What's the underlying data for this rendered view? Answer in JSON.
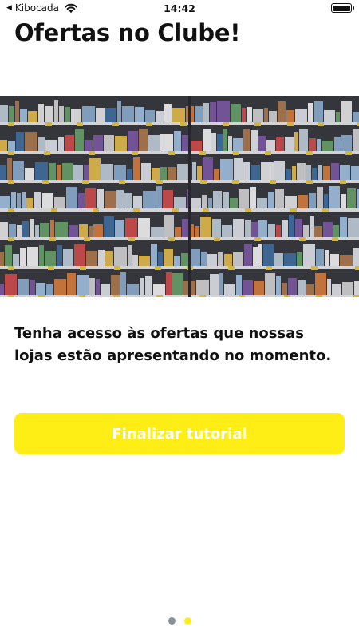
{
  "status_bar": {
    "back_symbol": "◀",
    "carrier": "Kibocada",
    "time": "14:42",
    "icons": [
      "back-arrow-icon",
      "wifi-icon",
      "battery-icon"
    ]
  },
  "screen": {
    "title": "Ofertas no Clube!",
    "hero_image": "supermarket-shelves-photo",
    "description": "Tenha acesso às ofertas que nossas lojas estão apresentando no momento.",
    "primary_button_label": "Finalizar tutorial"
  },
  "pager": {
    "pages": 2,
    "active_index": 1
  },
  "colors": {
    "accent": "#ffee15",
    "button_text": "#ffffff",
    "dot_inactive": "#8a9099",
    "text": "#111111"
  }
}
